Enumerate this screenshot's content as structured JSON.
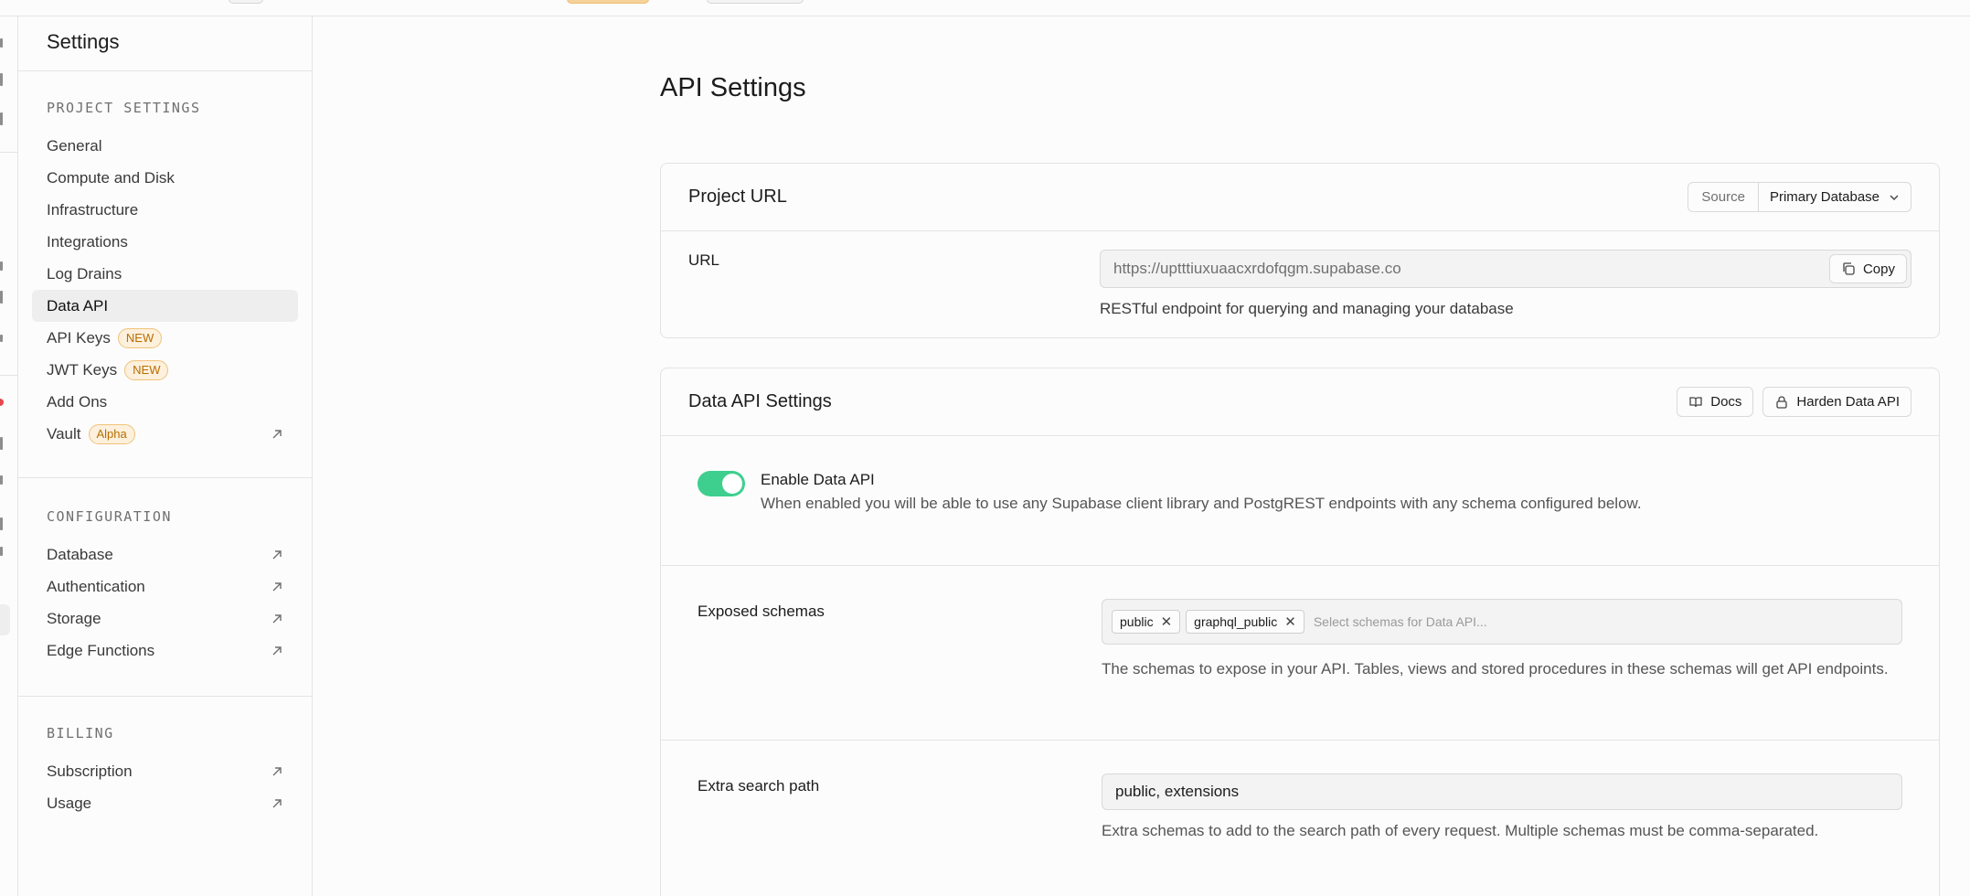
{
  "sidebar": {
    "title": "Settings",
    "sections": [
      {
        "heading": "PROJECT SETTINGS",
        "items": [
          {
            "label": "General"
          },
          {
            "label": "Compute and Disk"
          },
          {
            "label": "Infrastructure"
          },
          {
            "label": "Integrations"
          },
          {
            "label": "Log Drains"
          },
          {
            "label": "Data API",
            "active": true
          },
          {
            "label": "API Keys",
            "badge": "NEW"
          },
          {
            "label": "JWT Keys",
            "badge": "NEW"
          },
          {
            "label": "Add Ons"
          },
          {
            "label": "Vault",
            "badge": "Alpha",
            "external": true
          }
        ]
      },
      {
        "heading": "CONFIGURATION",
        "items": [
          {
            "label": "Database",
            "external": true
          },
          {
            "label": "Authentication",
            "external": true
          },
          {
            "label": "Storage",
            "external": true
          },
          {
            "label": "Edge Functions",
            "external": true
          }
        ]
      },
      {
        "heading": "BILLING",
        "items": [
          {
            "label": "Subscription",
            "external": true
          },
          {
            "label": "Usage",
            "external": true
          }
        ]
      }
    ]
  },
  "page": {
    "title": "API Settings"
  },
  "project_url": {
    "title": "Project URL",
    "source_label": "Source",
    "source_value": "Primary Database",
    "url_label": "URL",
    "url_value": "https://uptttiuxuaacxrdofqgm.supabase.co",
    "copy_label": "Copy",
    "url_help": "RESTful endpoint for querying and managing your database"
  },
  "data_api": {
    "title": "Data API Settings",
    "docs_label": "Docs",
    "harden_label": "Harden Data API",
    "enable_title": "Enable Data API",
    "enable_desc": "When enabled you will be able to use any Supabase client library and PostgREST endpoints with any schema configured below.",
    "enabled": true,
    "schemas_label": "Exposed schemas",
    "schemas": [
      "public",
      "graphql_public"
    ],
    "schemas_placeholder": "Select schemas for Data API...",
    "schemas_help": "The schemas to expose in your API. Tables, views and stored procedures in these schemas will get API endpoints.",
    "search_path_label": "Extra search path",
    "search_path_value": "public, extensions",
    "search_path_help": "Extra schemas to add to the search path of every request. Multiple schemas must be comma-separated."
  },
  "colors": {
    "toggle_on": "#3ecf8e",
    "badge_border": "#f0c27a",
    "badge_text": "#b76e00"
  }
}
